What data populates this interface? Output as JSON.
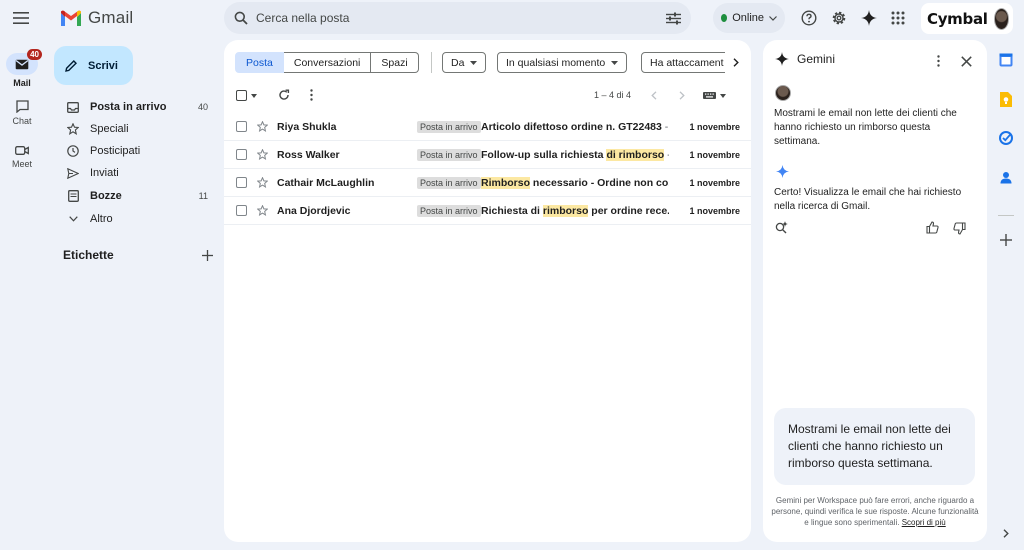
{
  "app": {
    "name": "Gmail",
    "brand": "Cymbal"
  },
  "search": {
    "placeholder": "Cerca nella posta"
  },
  "status": {
    "label": "Online",
    "color": "#1e8e3e"
  },
  "rail": [
    {
      "label": "Mail",
      "badge": "40",
      "icon": "mail-icon"
    },
    {
      "label": "Chat",
      "icon": "chat-icon"
    },
    {
      "label": "Meet",
      "icon": "video-icon"
    }
  ],
  "compose": {
    "label": "Scrivi"
  },
  "nav": [
    {
      "label": "Posta in arrivo",
      "count": "40",
      "icon": "inbox-icon"
    },
    {
      "label": "Speciali",
      "count": "",
      "icon": "star-icon"
    },
    {
      "label": "Posticipati",
      "count": "",
      "icon": "clock-icon"
    },
    {
      "label": "Inviati",
      "count": "",
      "icon": "send-icon"
    },
    {
      "label": "Bozze",
      "count": "11",
      "icon": "draft-icon"
    },
    {
      "label": "Altro",
      "count": "",
      "icon": "chevron-down-icon"
    }
  ],
  "labels_header": "Etichette",
  "tabs": [
    "Posta",
    "Conversazioni",
    "Spazi"
  ],
  "filters": [
    "Da",
    "In qualsiasi momento",
    "Ha attaccament"
  ],
  "range": "1 – 4 di 4",
  "emails": [
    {
      "sender": "Riya Shukla",
      "label": "Posta in arrivo",
      "subject_pre": "Articolo difettoso ordine n. GT22483",
      "subject_hl": "",
      "subject_post": "",
      "snippet": " - e",
      "date": "1 novembre"
    },
    {
      "sender": "Ross Walker",
      "label": "Posta in arrivo",
      "subject_pre": "Follow-up sulla richiesta ",
      "subject_hl": "di rimborso",
      "subject_post": "",
      "snippet": " - r",
      "date": "1 novembre"
    },
    {
      "sender": "Cathair McLaughlin",
      "label": "Posta in arrivo",
      "subject_pre": "",
      "subject_hl": "Rimborso",
      "subject_post": " necessario - Ordine non co...",
      "snippet": "",
      "date": "1 novembre"
    },
    {
      "sender": "Ana Djordjevic",
      "label": "Posta in arrivo",
      "subject_pre": "Richiesta di ",
      "subject_hl": "rimborso",
      "subject_post": " per ordine rece...",
      "snippet": "",
      "date": "1 novembre"
    }
  ],
  "gemini": {
    "title": "Gemini",
    "user_msg": "Mostrami le email non lette dei clienti che hanno richiesto un rimborso questa settimana.",
    "reply": "Certo! Visualizza le email che hai richiesto nella ricerca di Gmail.",
    "input": "Mostrami le email non lette dei clienti che hanno richiesto un rimborso questa settimana.",
    "disclaimer": "Gemini per Workspace può fare errori, anche riguardo a persone, quindi verifica le sue risposte. Alcune funzionalità e lingue sono sperimentali.",
    "link": "Scopri di più"
  }
}
